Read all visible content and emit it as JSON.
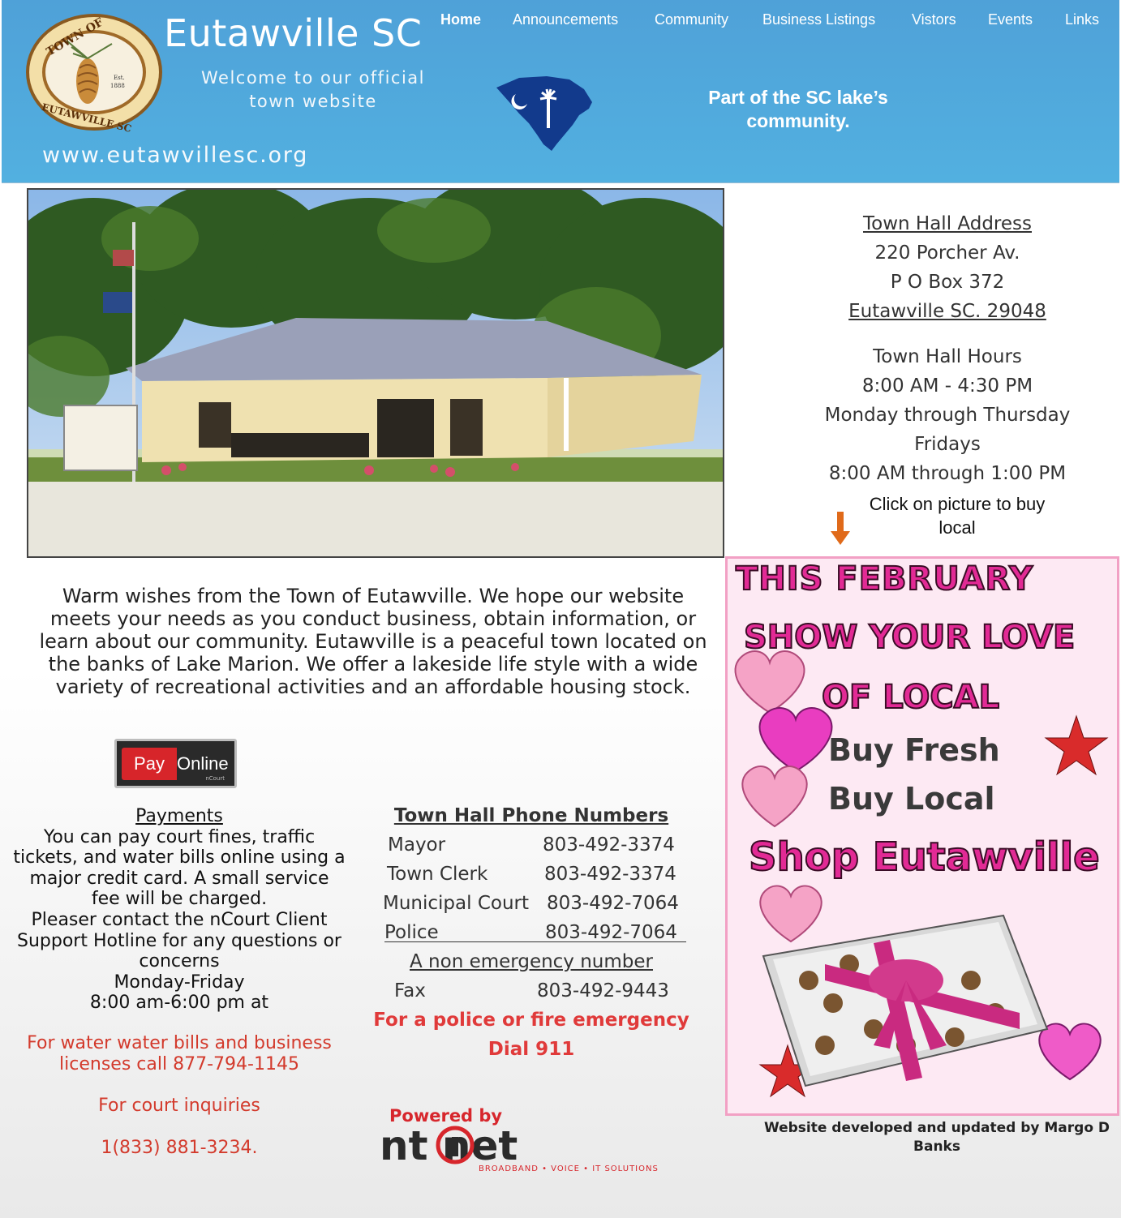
{
  "header": {
    "title": "Eutawville SC",
    "welcome": "Welcome to our official town website",
    "url": "www.eutawvillesc.org",
    "tagline": "Part of the SC lake’s community.",
    "seal": {
      "top_text": "TOWN OF",
      "bottom_text": "EUTAWVILLE SC",
      "est": "Est.",
      "year": "1888"
    }
  },
  "nav": {
    "items": [
      {
        "label": "Home",
        "active": true
      },
      {
        "label": "Announcements"
      },
      {
        "label": "Community"
      },
      {
        "label": "Business Listings"
      },
      {
        "label": "Vistors"
      },
      {
        "label": "Events"
      },
      {
        "label": "Links"
      }
    ]
  },
  "address": {
    "heading": "Town Hall Address",
    "street": "220 Porcher Av.",
    "pobox": "P O Box 372",
    "city": "Eutawville SC. 29048",
    "hours_heading": "Town Hall Hours",
    "hours_1": "8:00 AM - 4:30 PM",
    "days_1": "Monday through Thursday",
    "days_2": "Fridays",
    "hours_2": "8:00 AM through 1:00 PM",
    "click_note": "Click on picture to buy local"
  },
  "flyer": {
    "line1": "THIS FEBRUARY",
    "line2": "SHOW YOUR LOVE",
    "line3": "OF LOCAL",
    "line4": "Buy Fresh",
    "line5": "Buy Local",
    "line6": "Shop Eutawville"
  },
  "credit": "Website developed and updated by Margo D Banks",
  "intro": "Warm wishes from the Town of Eutawville. We hope our website meets your needs as you conduct business, obtain information, or learn about our community. Eutawville is a peaceful town  located on the banks of Lake Marion. We offer a lakeside life style with a wide variety of recreational activities and an affordable  housing stock.",
  "pay_button": {
    "pay": "Pay",
    "online": "Online",
    "brand": "nCourt"
  },
  "payments": {
    "heading": "Payments",
    "body": "You can pay court fines, traffic tickets, and water bills online using a major credit card. A small  service fee will be charged.",
    "contact": "Pleaser contact the nCourt Client Support Hotline for any questions or concerns",
    "days": "Monday-Friday",
    "hours": "8:00 am-6:00 pm at",
    "water_note": "For water water bills and business licenses call 877-794-1145",
    "court_note": "For court inquiries",
    "court_phone": "1(833) 881-3234."
  },
  "phones": {
    "heading": "Town Hall Phone Numbers",
    "rows": [
      {
        "label": "Mayor",
        "number": "803-492-3374"
      },
      {
        "label": "Town Clerk",
        "number": "803-492-3374"
      },
      {
        "label": "Municipal Court",
        "number": "803-492-7064"
      },
      {
        "label": "Police",
        "number": "803-492-7064"
      }
    ],
    "nonemergency_heading": "A non emergency number",
    "fax_label": "Fax",
    "fax_number": "803-492-9443",
    "emergency_1": "For a police or fire emergency",
    "emergency_2": "Dial 911"
  },
  "powered": {
    "label": "Powered by",
    "logo": "nt net",
    "tagline": "BROADBAND • VOICE • IT SOLUTIONS"
  },
  "colors": {
    "header_blue": "#4fa1d8",
    "emergency_red": "#e03a3a",
    "flyer_pink": "#e22a95",
    "flyer_bg": "#fde9f3"
  }
}
